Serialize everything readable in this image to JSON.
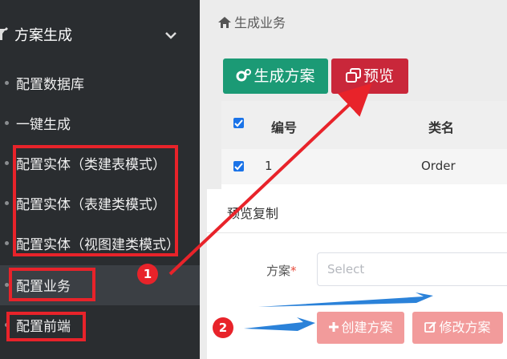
{
  "sidebar": {
    "section_title": "方案生成",
    "items": [
      {
        "label": "配置数据库"
      },
      {
        "label": "一键生成"
      },
      {
        "label": "配置实体（类建表模式）"
      },
      {
        "label": "配置实体（表建类模式）"
      },
      {
        "label": "配置实体（视图建类模式）"
      },
      {
        "label": "配置业务"
      },
      {
        "label": "配置前端"
      }
    ]
  },
  "breadcrumb": {
    "label": "生成业务"
  },
  "toolbar": {
    "generate_label": "生成方案",
    "preview_label": "预览"
  },
  "table": {
    "headers": [
      "编号",
      "类名"
    ],
    "rows": [
      {
        "id": "1",
        "class_name": "Order"
      }
    ]
  },
  "modal": {
    "title": "预览复制",
    "field_label": "方案",
    "required_mark": "*",
    "select_placeholder": "Select",
    "create_label": "创建方案",
    "edit_label": "修改方案"
  },
  "annotations": {
    "badge1": "1",
    "badge2": "2",
    "color": "#e8232a",
    "arrow_color": "#2b82d9"
  },
  "colors": {
    "sidebar_bg": "#2a2d30",
    "generate_btn": "#1b9a75",
    "preview_btn": "#c9273a",
    "disabled_btn": "#f29b9b",
    "checkbox": "#1a73e8"
  }
}
